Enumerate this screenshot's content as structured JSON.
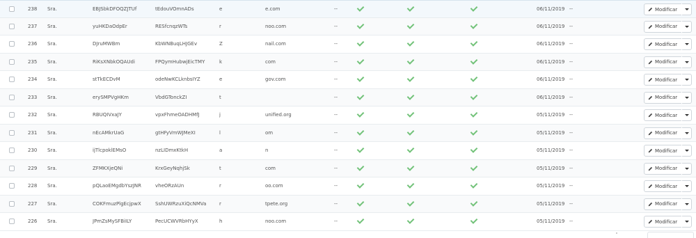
{
  "action_label": "Modificar",
  "none_value": "--",
  "colors": {
    "check": "#72c279",
    "row_highlight": "#f3f8fc",
    "border": "#e8ecef"
  },
  "rows": [
    {
      "id": "238",
      "social": "Sra.",
      "firstname": "EBJSbkDFOQZJTUf",
      "lastname": "tEdouVOmnADs",
      "email_start": "e",
      "email_end": "e.com",
      "sales": "--",
      "newsletter": true,
      "optin": true,
      "enabled": true,
      "date": "06/11/2019",
      "last_visit": "--"
    },
    {
      "id": "237",
      "social": "Sra.",
      "firstname": "yuHKDaOdpEr",
      "lastname": "RESfcnqzWTs",
      "email_start": "r",
      "email_end": "noo.com",
      "sales": "--",
      "newsletter": true,
      "optin": true,
      "enabled": true,
      "date": "06/11/2019",
      "last_visit": "--"
    },
    {
      "id": "236",
      "social": "Sra.",
      "firstname": "DJruMWBm",
      "lastname": "KbWNBuqLHJGEv",
      "email_start": "Z",
      "email_end": "nail.com",
      "sales": "--",
      "newsletter": true,
      "optin": true,
      "enabled": true,
      "date": "06/11/2019",
      "last_visit": "--"
    },
    {
      "id": "235",
      "social": "Sra.",
      "firstname": "RiKsXNbkOQAUdi",
      "lastname": "FPQymHubwjEicTMY",
      "email_start": "k",
      "email_end": "com",
      "sales": "--",
      "newsletter": true,
      "optin": true,
      "enabled": true,
      "date": "06/11/2019",
      "last_visit": "--"
    },
    {
      "id": "234",
      "social": "Sra.",
      "firstname": "stTkECDvM",
      "lastname": "odeNwKCLknbsIYZ",
      "email_start": "e",
      "email_end": "gov.com",
      "sales": "--",
      "newsletter": true,
      "optin": true,
      "enabled": true,
      "date": "06/11/2019",
      "last_visit": "--"
    },
    {
      "id": "233",
      "social": "Sra.",
      "firstname": "erySMPVgHKm",
      "lastname": "VbdGTonckZI",
      "email_start": "t",
      "email_end": "",
      "sales": "--",
      "newsletter": true,
      "optin": true,
      "enabled": true,
      "date": "06/11/2019",
      "last_visit": "--"
    },
    {
      "id": "232",
      "social": "Sra.",
      "firstname": "RBUQIVxaJY",
      "lastname": "vpxFhmeOADHMfJ",
      "email_start": "j",
      "email_end": "unified.org",
      "sales": "--",
      "newsletter": true,
      "optin": true,
      "enabled": true,
      "date": "05/11/2019",
      "last_visit": "--"
    },
    {
      "id": "231",
      "social": "Sra.",
      "firstname": "nEcAMkrUaG",
      "lastname": "gtHFyVmWJMeXI",
      "email_start": "l",
      "email_end": "om",
      "sales": "--",
      "newsletter": true,
      "optin": true,
      "enabled": true,
      "date": "05/11/2019",
      "last_visit": "--"
    },
    {
      "id": "230",
      "social": "Sra.",
      "firstname": "ijTlcpoklEMsO",
      "lastname": "nzLIDmxKtkH",
      "email_start": "a",
      "email_end": "n",
      "sales": "--",
      "newsletter": true,
      "optin": true,
      "enabled": true,
      "date": "05/11/2019",
      "last_visit": "--"
    },
    {
      "id": "229",
      "social": "Sra.",
      "firstname": "ZFMKXjeQNi",
      "lastname": "KrxGeyNqhjSk",
      "email_start": "t",
      "email_end": "com",
      "sales": "--",
      "newsletter": true,
      "optin": true,
      "enabled": true,
      "date": "05/11/2019",
      "last_visit": "--"
    },
    {
      "id": "228",
      "social": "Sra.",
      "firstname": "pQLaoEMgdbYszJNR",
      "lastname": "vheORzAUn",
      "email_start": "r",
      "email_end": "oo.com",
      "sales": "--",
      "newsletter": true,
      "optin": true,
      "enabled": true,
      "date": "05/11/2019",
      "last_visit": "--"
    },
    {
      "id": "227",
      "social": "Sra.",
      "firstname": "COKFmuzPlgEcjpwX",
      "lastname": "SshUWRzuXiQcNMVa",
      "email_start": "r",
      "email_end": "tpete.org",
      "sales": "--",
      "newsletter": true,
      "optin": true,
      "enabled": true,
      "date": "05/11/2019",
      "last_visit": "--"
    },
    {
      "id": "226",
      "social": "Sra.",
      "firstname": "JPmZsMySFBiILY",
      "lastname": "PecUCWVRbHYyX",
      "email_start": "h",
      "email_end": "noo.com",
      "sales": "--",
      "newsletter": true,
      "optin": true,
      "enabled": true,
      "date": "05/11/2019",
      "last_visit": "--"
    }
  ]
}
